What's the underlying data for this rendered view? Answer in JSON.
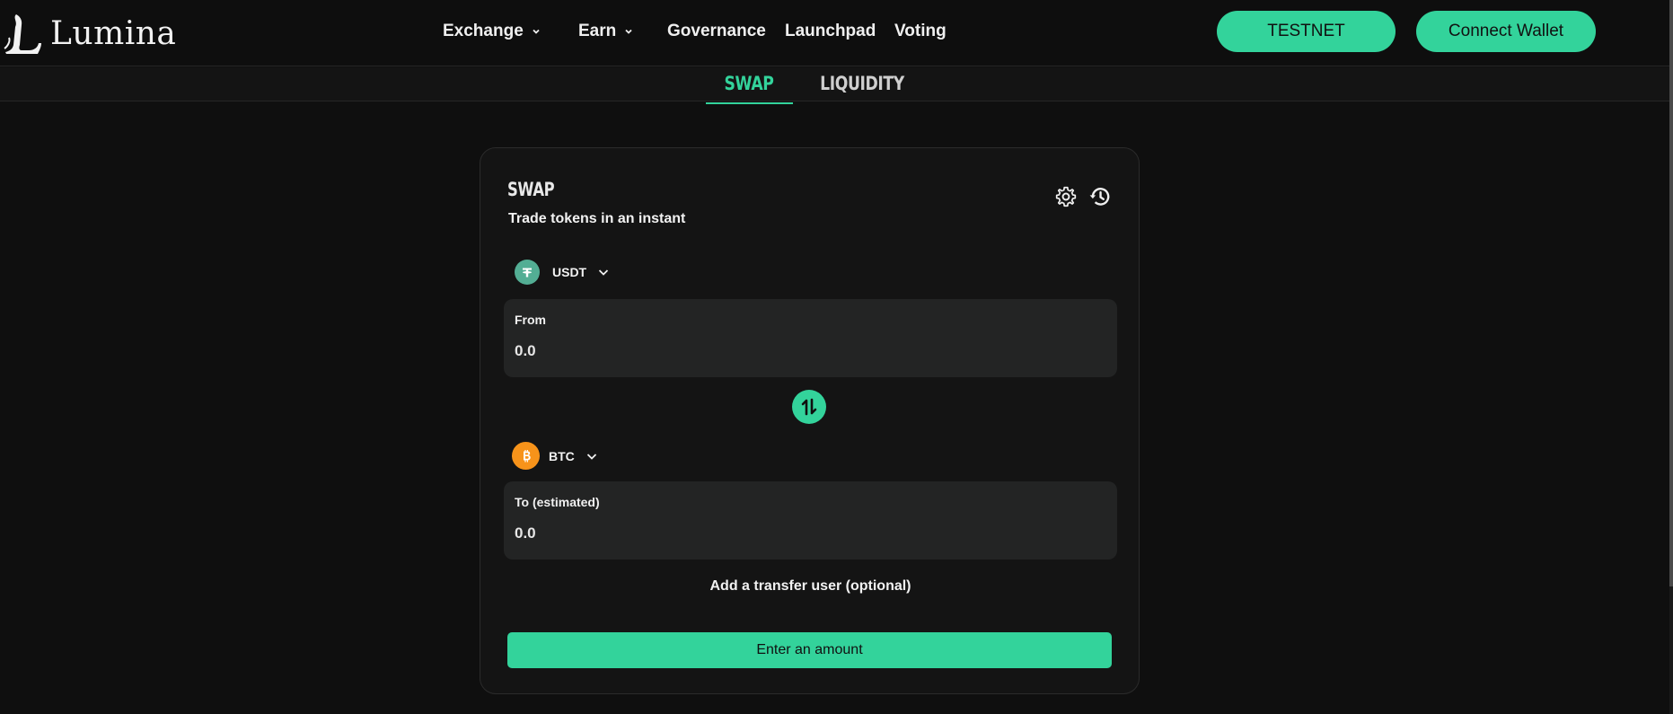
{
  "brand": {
    "name": "Lumina"
  },
  "nav": {
    "items": [
      {
        "label": "Exchange",
        "has_dropdown": true
      },
      {
        "label": "Earn",
        "has_dropdown": true
      },
      {
        "label": "Governance",
        "has_dropdown": false
      },
      {
        "label": "Launchpad",
        "has_dropdown": false
      },
      {
        "label": "Voting",
        "has_dropdown": false
      }
    ]
  },
  "header_buttons": {
    "network": "TESTNET",
    "connect": "Connect Wallet"
  },
  "tabs": [
    {
      "label": "SWAP",
      "active": true
    },
    {
      "label": "LIQUIDITY",
      "active": false
    }
  ],
  "swap": {
    "title": "SWAP",
    "subtitle": "Trade tokens in an instant",
    "from": {
      "token": "USDT",
      "token_icon": "tether-icon",
      "label": "From",
      "placeholder": "0.0"
    },
    "to": {
      "token": "BTC",
      "token_icon": "bitcoin-icon",
      "label": "To (estimated)",
      "placeholder": "0.0"
    },
    "transfer_link": "Add a transfer user (optional)",
    "submit_label": "Enter an amount"
  },
  "colors": {
    "accent": "#33d39b",
    "background": "#0f0f0f",
    "card": "#141414",
    "field": "#232424",
    "usdt": "#53ae94",
    "btc": "#f7931a"
  }
}
